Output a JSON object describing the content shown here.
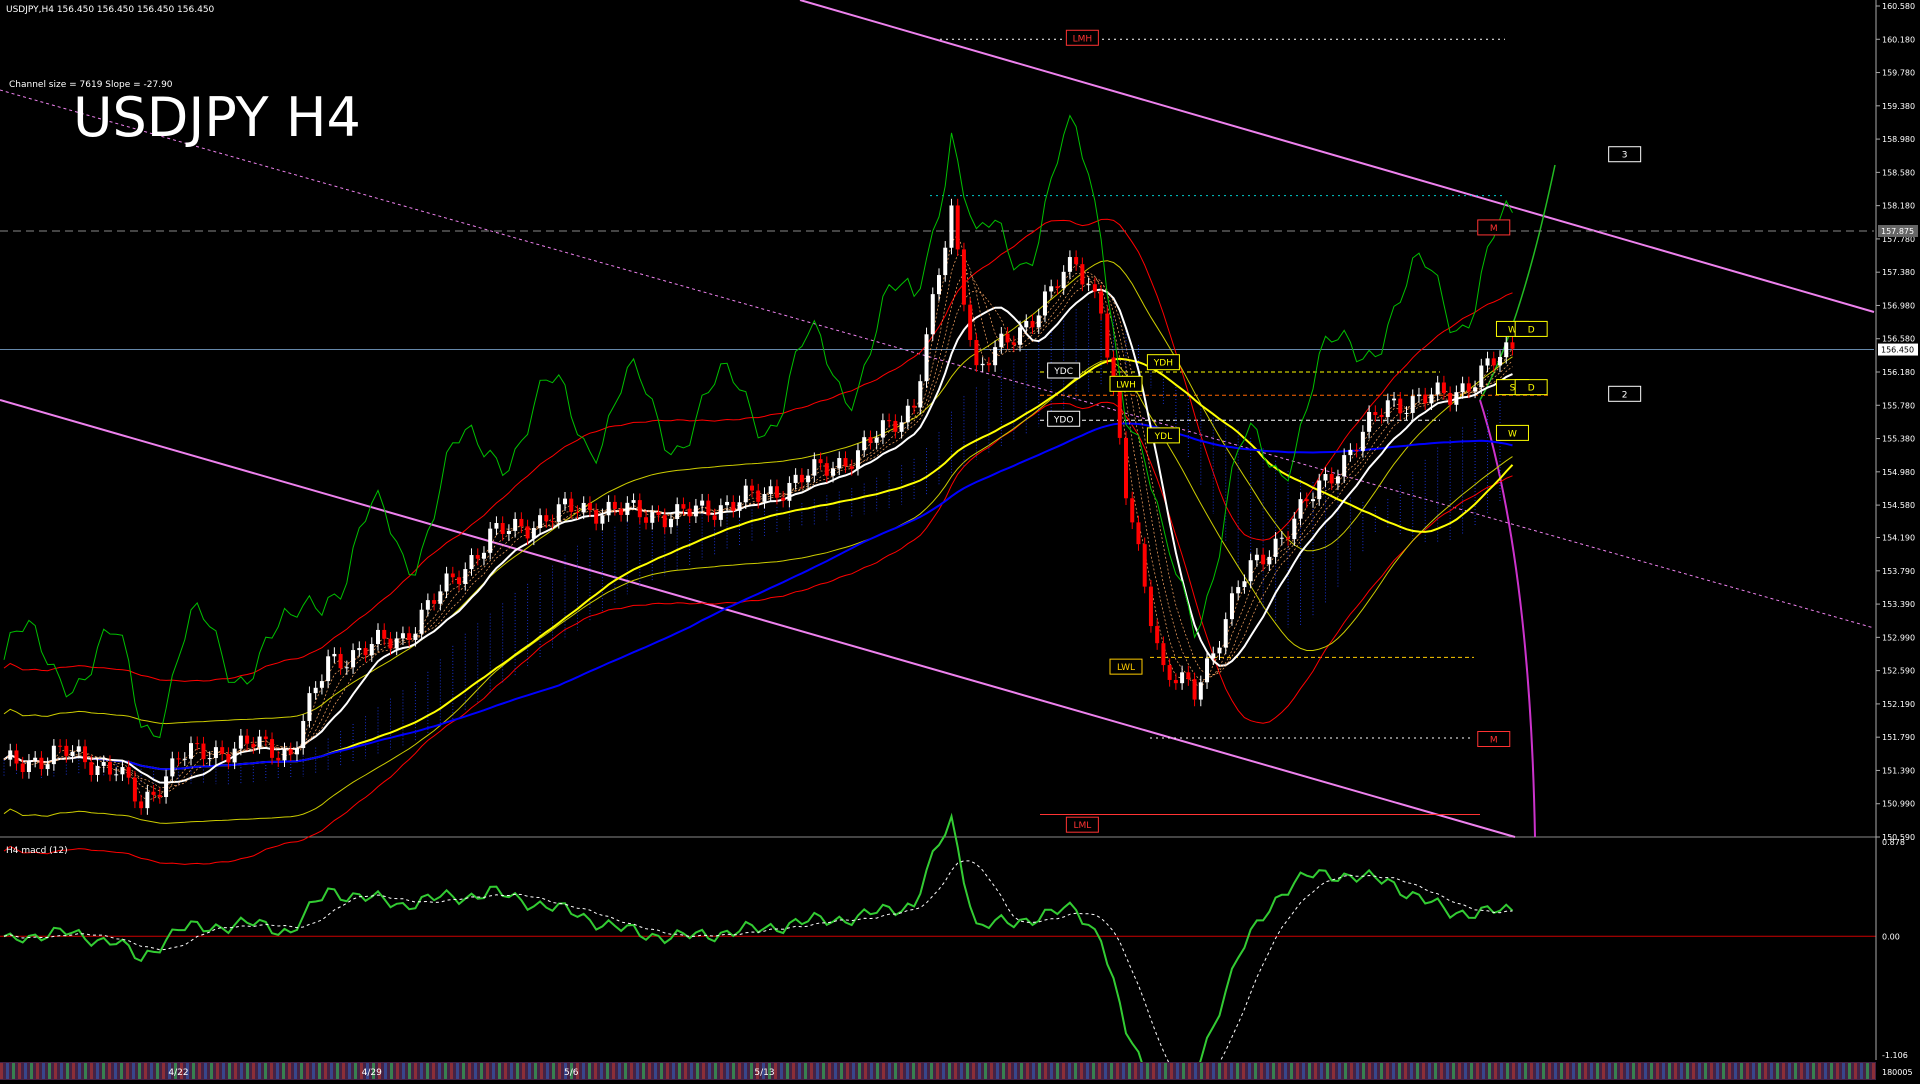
{
  "window": {
    "symbol_header": "USDJPY,H4  156.450 156.450 156.450 156.450",
    "channel_info": "Channel size = 7619 Slope = -27.90",
    "big_title": "USDJPY H4",
    "current_price": "156.450",
    "marker_price": "157.875"
  },
  "colors": {
    "background": "#000000",
    "bull_candle": "#ffffff",
    "bear_candle": "#ff0000",
    "channel": "#ee82ee",
    "cloud": "#1e3cff",
    "ma_white": "#ffffff",
    "ma_yellow": "#ffff00",
    "ma_blue": "#0000ff",
    "bollinger": "#ff0000",
    "envelope": "#cccc00",
    "green_ind": "#00c000",
    "macd_main": "#33cc33",
    "macd_neg": "#ff99aa",
    "zero_line": "#cc0000"
  },
  "chart_data": [
    {
      "type": "candlestick",
      "title": "USDJPY H4",
      "ylim": [
        150.59,
        160.58
      ],
      "y_ticks": [
        "160.580",
        "160.180",
        "159.780",
        "159.380",
        "158.980",
        "158.580",
        "158.180",
        "157.780",
        "157.380",
        "156.980",
        "156.580",
        "156.180",
        "155.780",
        "155.380",
        "154.980",
        "154.580",
        "154.190",
        "153.790",
        "153.390",
        "152.990",
        "152.590",
        "152.190",
        "151.790",
        "151.390",
        "150.990",
        "150.590"
      ],
      "x_ticks": [
        "4/22",
        "4/29",
        "5/6",
        "5/13"
      ],
      "anchors": [
        {
          "i": 0,
          "p": 151.45
        },
        {
          "i": 10,
          "p": 151.6
        },
        {
          "i": 18,
          "p": 151.4
        },
        {
          "i": 22,
          "p": 150.95
        },
        {
          "i": 28,
          "p": 151.55
        },
        {
          "i": 40,
          "p": 151.7
        },
        {
          "i": 46,
          "p": 151.6
        },
        {
          "i": 52,
          "p": 152.7
        },
        {
          "i": 64,
          "p": 153.0
        },
        {
          "i": 78,
          "p": 154.2
        },
        {
          "i": 92,
          "p": 154.55
        },
        {
          "i": 108,
          "p": 154.45
        },
        {
          "i": 122,
          "p": 154.7
        },
        {
          "i": 137,
          "p": 155.2
        },
        {
          "i": 146,
          "p": 155.8
        },
        {
          "i": 152,
          "p": 158.1
        },
        {
          "i": 156,
          "p": 156.2
        },
        {
          "i": 162,
          "p": 156.6
        },
        {
          "i": 172,
          "p": 157.5
        },
        {
          "i": 176,
          "p": 157.0
        },
        {
          "i": 180,
          "p": 154.7
        },
        {
          "i": 186,
          "p": 152.6
        },
        {
          "i": 191,
          "p": 152.3
        },
        {
          "i": 198,
          "p": 153.6
        },
        {
          "i": 208,
          "p": 154.5
        },
        {
          "i": 222,
          "p": 155.8
        },
        {
          "i": 232,
          "p": 155.9
        },
        {
          "i": 242,
          "p": 156.45
        }
      ],
      "series_names": [],
      "labels": [
        {
          "text": "LMH",
          "x": 173,
          "y": 160.18,
          "color": "#ff3333"
        },
        {
          "text": "LML",
          "x": 173,
          "y": 150.72,
          "color": "#ff3333"
        },
        {
          "text": "M",
          "x": 239,
          "y": 157.9,
          "color": "#ff3333"
        },
        {
          "text": "M",
          "x": 239,
          "y": 151.75,
          "color": "#ff3333"
        },
        {
          "text": "YDC",
          "x": 170,
          "y": 156.18,
          "color": "#ffffff"
        },
        {
          "text": "YDO",
          "x": 170,
          "y": 155.6,
          "color": "#ffffff"
        },
        {
          "text": "YDH",
          "x": 186,
          "y": 156.28,
          "color": "#ffff00"
        },
        {
          "text": "LWH",
          "x": 180,
          "y": 156.02,
          "color": "#ffff00"
        },
        {
          "text": "YDL",
          "x": 186,
          "y": 155.4,
          "color": "#ffff00"
        },
        {
          "text": "LWL",
          "x": 180,
          "y": 152.62,
          "color": "#ffcc00"
        },
        {
          "text": "W",
          "x": 242,
          "y": 156.68,
          "color": "#ffff00"
        },
        {
          "text": "D",
          "x": 245,
          "y": 156.68,
          "color": "#ffff00"
        },
        {
          "text": "S",
          "x": 242,
          "y": 155.98,
          "color": "#ffff00"
        },
        {
          "text": "D",
          "x": 245,
          "y": 155.98,
          "color": "#ffff00"
        },
        {
          "text": "W",
          "x": 242,
          "y": 155.43,
          "color": "#ffff00"
        },
        {
          "text": "3",
          "x": 260,
          "y": 158.78,
          "color": "#ffffff"
        },
        {
          "text": "2",
          "x": 260,
          "y": 155.9,
          "color": "#ffffff"
        }
      ]
    },
    {
      "type": "line",
      "title": "H4  macd (12)",
      "ylim": [
        -1.106,
        0.878
      ],
      "y_ticks": [
        "0.878",
        "0.00",
        "-1.106"
      ],
      "zero_label": "0.00"
    }
  ],
  "bottom_label": "180005"
}
